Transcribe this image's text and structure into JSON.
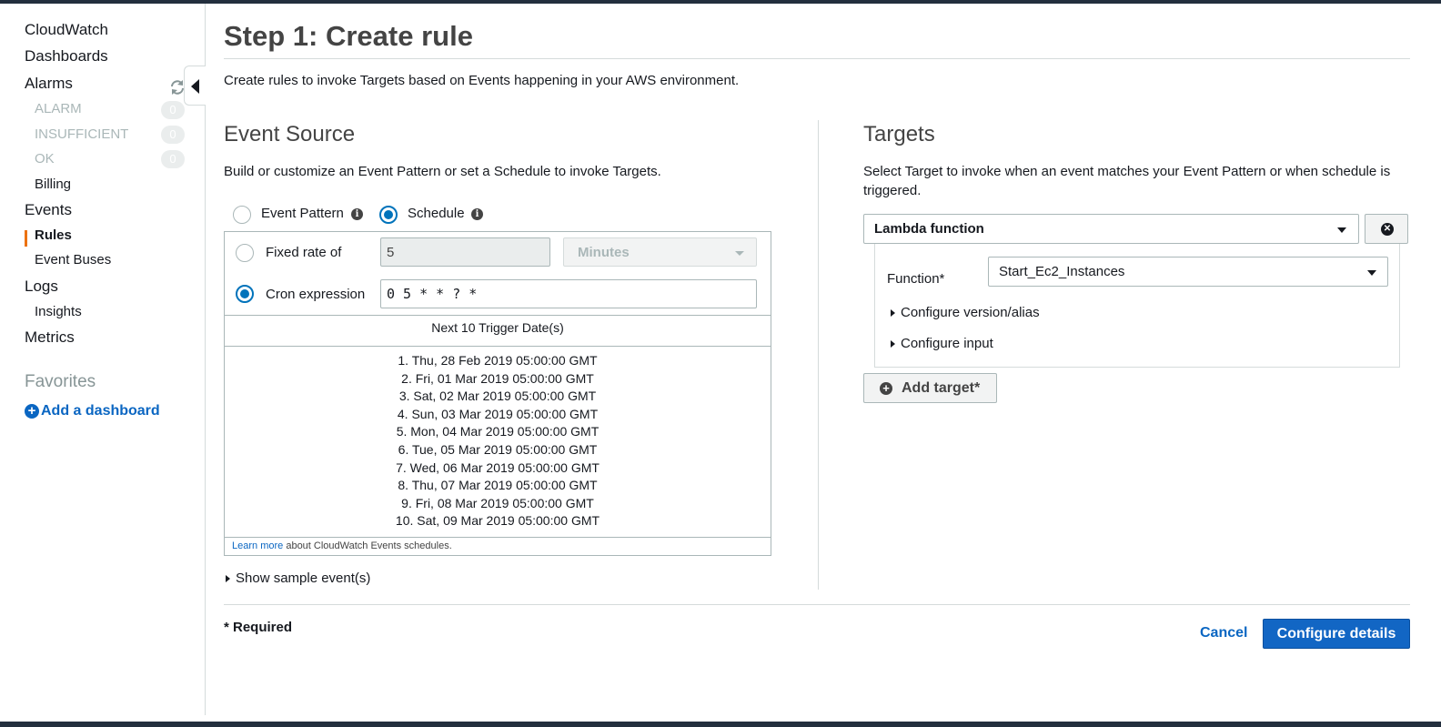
{
  "sidebar": {
    "cloudwatch": "CloudWatch",
    "dashboards": "Dashboards",
    "alarms": "Alarms",
    "alarm_states": [
      {
        "label": "ALARM",
        "count": "0"
      },
      {
        "label": "INSUFFICIENT",
        "count": "0"
      },
      {
        "label": "OK",
        "count": "0"
      }
    ],
    "billing": "Billing",
    "events": "Events",
    "rules": "Rules",
    "event_buses": "Event Buses",
    "logs": "Logs",
    "insights": "Insights",
    "metrics": "Metrics",
    "favorites": "Favorites",
    "add_dashboard": "Add a dashboard"
  },
  "page": {
    "title": "Step 1: Create rule",
    "intro": "Create rules to invoke Targets based on Events happening in your AWS environment."
  },
  "event_source": {
    "heading": "Event Source",
    "description": "Build or customize an Event Pattern or set a Schedule to invoke Targets.",
    "event_pattern_label": "Event Pattern",
    "schedule_label": "Schedule",
    "fixed_rate_label": "Fixed rate of",
    "fixed_rate_value": "5",
    "rate_unit": "Minutes",
    "cron_label": "Cron expression",
    "cron_value": "0 5 * * ? *",
    "next_header": "Next 10 Trigger Date(s)",
    "trigger_dates": [
      "1. Thu, 28 Feb 2019 05:00:00 GMT",
      "2. Fri, 01 Mar 2019 05:00:00 GMT",
      "3. Sat, 02 Mar 2019 05:00:00 GMT",
      "4. Sun, 03 Mar 2019 05:00:00 GMT",
      "5. Mon, 04 Mar 2019 05:00:00 GMT",
      "6. Tue, 05 Mar 2019 05:00:00 GMT",
      "7. Wed, 06 Mar 2019 05:00:00 GMT",
      "8. Thu, 07 Mar 2019 05:00:00 GMT",
      "9. Fri, 08 Mar 2019 05:00:00 GMT",
      "10. Sat, 09 Mar 2019 05:00:00 GMT"
    ],
    "learn_more_link": "Learn more",
    "learn_more_text": "about CloudWatch Events schedules.",
    "show_sample": "Show sample event(s)"
  },
  "targets": {
    "heading": "Targets",
    "description": "Select Target to invoke when an event matches your Event Pattern or when schedule is triggered.",
    "target_type": "Lambda function",
    "function_label": "Function*",
    "function_value": "Start_Ec2_Instances",
    "configure_version": "Configure version/alias",
    "configure_input": "Configure input",
    "add_target": "Add target*"
  },
  "footer": {
    "required": "* Required",
    "cancel": "Cancel",
    "configure_details": "Configure details"
  },
  "colors": {
    "accent_blue": "#0073bb",
    "primary_button": "#1266c4",
    "active_marker": "#ec7211",
    "top_bar": "#232f3e"
  }
}
